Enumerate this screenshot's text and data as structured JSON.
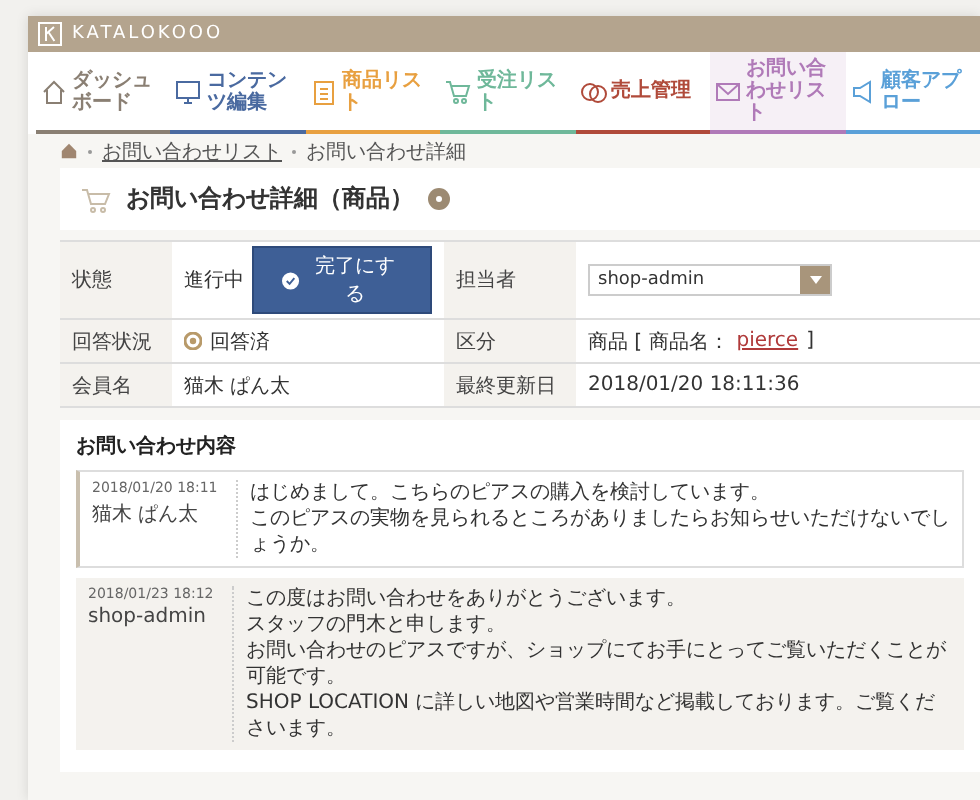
{
  "header": {
    "brand": "KATALOKOOO"
  },
  "nav": [
    {
      "label": "ダッシュボード",
      "color": "#8a7f73",
      "selected": false
    },
    {
      "label": "コンテンツ編集",
      "color": "#4a6aa0",
      "selected": false
    },
    {
      "label": "商品リスト",
      "color": "#e8a040",
      "selected": false
    },
    {
      "label": "受注リスト",
      "color": "#6fb89a",
      "selected": false
    },
    {
      "label": "売上管理",
      "color": "#b04a3a",
      "selected": false
    },
    {
      "label": "お問い合わせリスト",
      "color": "#b07ab8",
      "selected": true
    },
    {
      "label": "顧客アプロー",
      "color": "#5aa0d8",
      "selected": false
    }
  ],
  "breadcrumb": [
    {
      "label": "お問い合わせリスト",
      "link": true
    },
    {
      "label": "お問い合わせ詳細",
      "link": false
    }
  ],
  "page_title": "お問い合わせ詳細（商品）",
  "details": {
    "status_label": "状態",
    "status_value": "進行中",
    "complete_button": "完了にする",
    "assignee_label": "担当者",
    "assignee_value": "shop-admin",
    "answer_label": "回答状況",
    "answer_value": "回答済",
    "category_label": "区分",
    "category_prefix": "商品 [ 商品名：",
    "category_link": "pierce",
    "category_suffix": "]",
    "member_label": "会員名",
    "member_value": "猫木 ぱん太",
    "updated_label": "最終更新日",
    "updated_value": "2018/01/20 18:11:36"
  },
  "messages_title": "お問い合わせ内容",
  "messages": [
    {
      "kind": "customer",
      "datetime": "2018/01/20 18:11",
      "author": "猫木 ぱん太",
      "lines": [
        "はじめまして。こちらのピアスの購入を検討しています。",
        "このピアスの実物を見られるところがありましたらお知らせいただけないでしょうか。"
      ]
    },
    {
      "kind": "shop",
      "datetime": "2018/01/23 18:12",
      "author": "shop-admin",
      "lines": [
        "この度はお問い合わせをありがとうございます。",
        "スタッフの門木と申します。",
        "お問い合わせのピアスですが、ショップにてお手にとってご覧いただくことが可能です。",
        "SHOP LOCATION に詳しい地図や営業時間など掲載しております。ご覧くださいます。"
      ]
    }
  ]
}
